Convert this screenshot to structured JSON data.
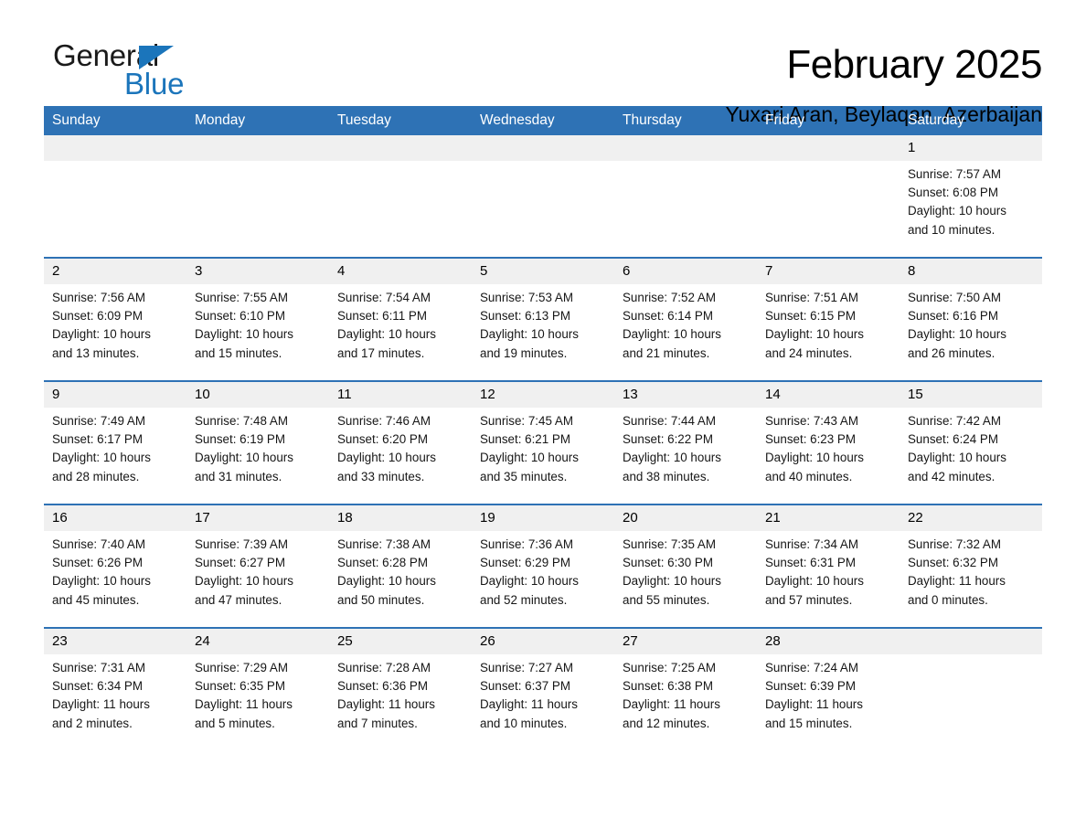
{
  "logo": {
    "line1": "General",
    "line2": "Blue",
    "triangle_color": "#1b75bb",
    "text_color": "#1a1a1a"
  },
  "header": {
    "title": "February 2025",
    "subtitle": "Yuxari Aran, Beylaqan, Azerbaijan"
  },
  "theme": {
    "header_blue": "#2e72b5",
    "date_band": "#f0f0f0",
    "cell_background": "#ffffff",
    "text": "#161616"
  },
  "calendar": {
    "weekdays": [
      "Sunday",
      "Monday",
      "Tuesday",
      "Wednesday",
      "Thursday",
      "Friday",
      "Saturday"
    ],
    "labels": {
      "sunrise": "Sunrise:",
      "sunset": "Sunset:",
      "daylight": "Daylight:"
    },
    "weeks": [
      [
        {
          "day": "",
          "empty": true
        },
        {
          "day": "",
          "empty": true
        },
        {
          "day": "",
          "empty": true
        },
        {
          "day": "",
          "empty": true
        },
        {
          "day": "",
          "empty": true
        },
        {
          "day": "",
          "empty": true
        },
        {
          "day": "1",
          "sunrise": "Sunrise: 7:57 AM",
          "sunset": "Sunset: 6:08 PM",
          "daylight1": "Daylight: 10 hours",
          "daylight2": "and 10 minutes."
        }
      ],
      [
        {
          "day": "2",
          "sunrise": "Sunrise: 7:56 AM",
          "sunset": "Sunset: 6:09 PM",
          "daylight1": "Daylight: 10 hours",
          "daylight2": "and 13 minutes."
        },
        {
          "day": "3",
          "sunrise": "Sunrise: 7:55 AM",
          "sunset": "Sunset: 6:10 PM",
          "daylight1": "Daylight: 10 hours",
          "daylight2": "and 15 minutes."
        },
        {
          "day": "4",
          "sunrise": "Sunrise: 7:54 AM",
          "sunset": "Sunset: 6:11 PM",
          "daylight1": "Daylight: 10 hours",
          "daylight2": "and 17 minutes."
        },
        {
          "day": "5",
          "sunrise": "Sunrise: 7:53 AM",
          "sunset": "Sunset: 6:13 PM",
          "daylight1": "Daylight: 10 hours",
          "daylight2": "and 19 minutes."
        },
        {
          "day": "6",
          "sunrise": "Sunrise: 7:52 AM",
          "sunset": "Sunset: 6:14 PM",
          "daylight1": "Daylight: 10 hours",
          "daylight2": "and 21 minutes."
        },
        {
          "day": "7",
          "sunrise": "Sunrise: 7:51 AM",
          "sunset": "Sunset: 6:15 PM",
          "daylight1": "Daylight: 10 hours",
          "daylight2": "and 24 minutes."
        },
        {
          "day": "8",
          "sunrise": "Sunrise: 7:50 AM",
          "sunset": "Sunset: 6:16 PM",
          "daylight1": "Daylight: 10 hours",
          "daylight2": "and 26 minutes."
        }
      ],
      [
        {
          "day": "9",
          "sunrise": "Sunrise: 7:49 AM",
          "sunset": "Sunset: 6:17 PM",
          "daylight1": "Daylight: 10 hours",
          "daylight2": "and 28 minutes."
        },
        {
          "day": "10",
          "sunrise": "Sunrise: 7:48 AM",
          "sunset": "Sunset: 6:19 PM",
          "daylight1": "Daylight: 10 hours",
          "daylight2": "and 31 minutes."
        },
        {
          "day": "11",
          "sunrise": "Sunrise: 7:46 AM",
          "sunset": "Sunset: 6:20 PM",
          "daylight1": "Daylight: 10 hours",
          "daylight2": "and 33 minutes."
        },
        {
          "day": "12",
          "sunrise": "Sunrise: 7:45 AM",
          "sunset": "Sunset: 6:21 PM",
          "daylight1": "Daylight: 10 hours",
          "daylight2": "and 35 minutes."
        },
        {
          "day": "13",
          "sunrise": "Sunrise: 7:44 AM",
          "sunset": "Sunset: 6:22 PM",
          "daylight1": "Daylight: 10 hours",
          "daylight2": "and 38 minutes."
        },
        {
          "day": "14",
          "sunrise": "Sunrise: 7:43 AM",
          "sunset": "Sunset: 6:23 PM",
          "daylight1": "Daylight: 10 hours",
          "daylight2": "and 40 minutes."
        },
        {
          "day": "15",
          "sunrise": "Sunrise: 7:42 AM",
          "sunset": "Sunset: 6:24 PM",
          "daylight1": "Daylight: 10 hours",
          "daylight2": "and 42 minutes."
        }
      ],
      [
        {
          "day": "16",
          "sunrise": "Sunrise: 7:40 AM",
          "sunset": "Sunset: 6:26 PM",
          "daylight1": "Daylight: 10 hours",
          "daylight2": "and 45 minutes."
        },
        {
          "day": "17",
          "sunrise": "Sunrise: 7:39 AM",
          "sunset": "Sunset: 6:27 PM",
          "daylight1": "Daylight: 10 hours",
          "daylight2": "and 47 minutes."
        },
        {
          "day": "18",
          "sunrise": "Sunrise: 7:38 AM",
          "sunset": "Sunset: 6:28 PM",
          "daylight1": "Daylight: 10 hours",
          "daylight2": "and 50 minutes."
        },
        {
          "day": "19",
          "sunrise": "Sunrise: 7:36 AM",
          "sunset": "Sunset: 6:29 PM",
          "daylight1": "Daylight: 10 hours",
          "daylight2": "and 52 minutes."
        },
        {
          "day": "20",
          "sunrise": "Sunrise: 7:35 AM",
          "sunset": "Sunset: 6:30 PM",
          "daylight1": "Daylight: 10 hours",
          "daylight2": "and 55 minutes."
        },
        {
          "day": "21",
          "sunrise": "Sunrise: 7:34 AM",
          "sunset": "Sunset: 6:31 PM",
          "daylight1": "Daylight: 10 hours",
          "daylight2": "and 57 minutes."
        },
        {
          "day": "22",
          "sunrise": "Sunrise: 7:32 AM",
          "sunset": "Sunset: 6:32 PM",
          "daylight1": "Daylight: 11 hours",
          "daylight2": "and 0 minutes."
        }
      ],
      [
        {
          "day": "23",
          "sunrise": "Sunrise: 7:31 AM",
          "sunset": "Sunset: 6:34 PM",
          "daylight1": "Daylight: 11 hours",
          "daylight2": "and 2 minutes."
        },
        {
          "day": "24",
          "sunrise": "Sunrise: 7:29 AM",
          "sunset": "Sunset: 6:35 PM",
          "daylight1": "Daylight: 11 hours",
          "daylight2": "and 5 minutes."
        },
        {
          "day": "25",
          "sunrise": "Sunrise: 7:28 AM",
          "sunset": "Sunset: 6:36 PM",
          "daylight1": "Daylight: 11 hours",
          "daylight2": "and 7 minutes."
        },
        {
          "day": "26",
          "sunrise": "Sunrise: 7:27 AM",
          "sunset": "Sunset: 6:37 PM",
          "daylight1": "Daylight: 11 hours",
          "daylight2": "and 10 minutes."
        },
        {
          "day": "27",
          "sunrise": "Sunrise: 7:25 AM",
          "sunset": "Sunset: 6:38 PM",
          "daylight1": "Daylight: 11 hours",
          "daylight2": "and 12 minutes."
        },
        {
          "day": "28",
          "sunrise": "Sunrise: 7:24 AM",
          "sunset": "Sunset: 6:39 PM",
          "daylight1": "Daylight: 11 hours",
          "daylight2": "and 15 minutes."
        },
        {
          "day": "",
          "empty": true,
          "last_blank": true
        }
      ]
    ]
  }
}
